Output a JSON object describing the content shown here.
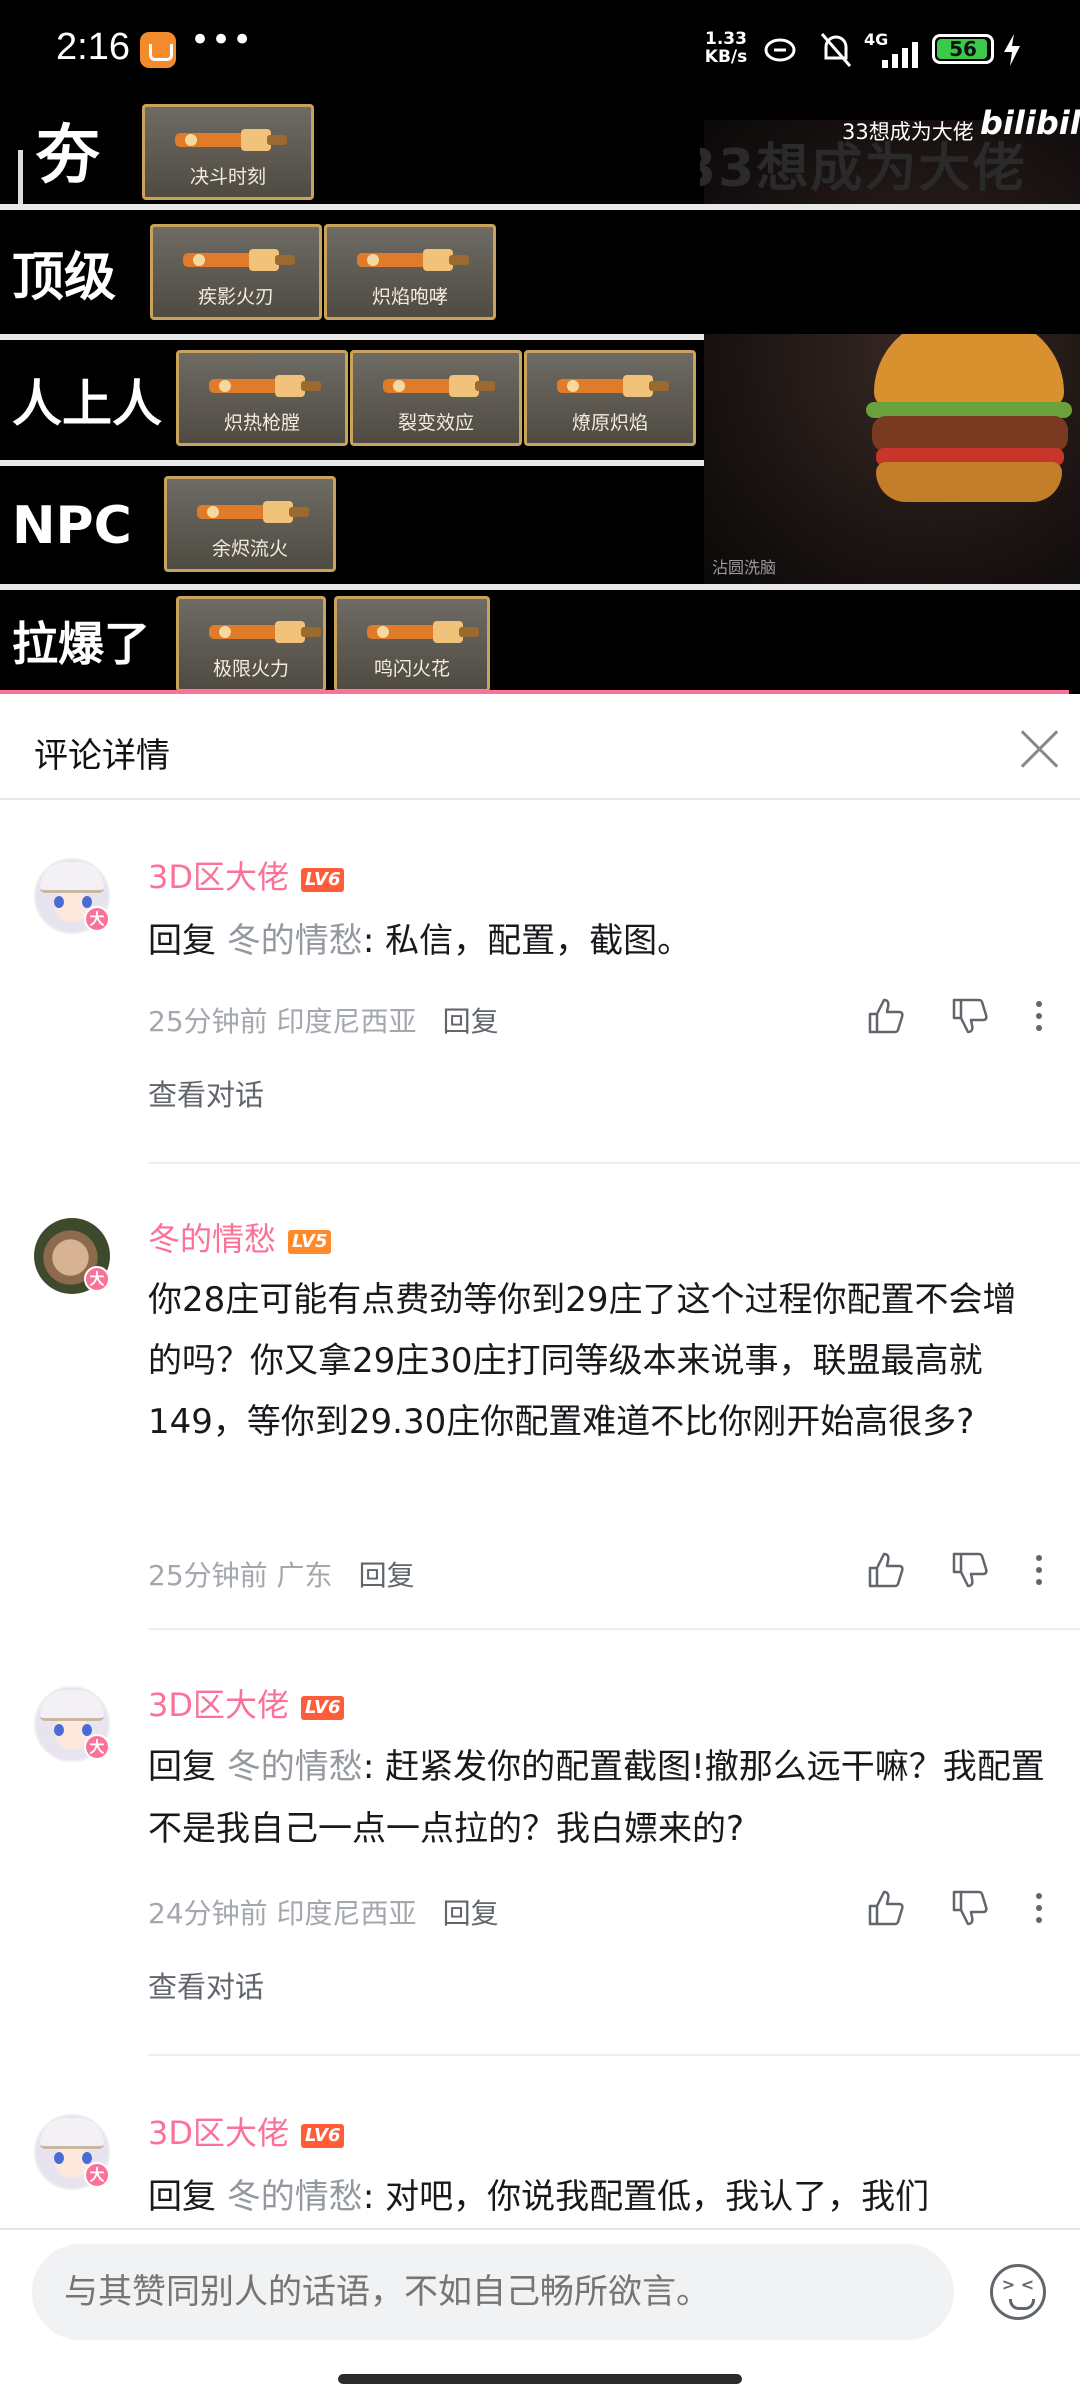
{
  "status_bar": {
    "time": "2:16",
    "more": "•••",
    "net_speed_value": "1.33",
    "net_speed_unit": "KB/s",
    "network": "4G",
    "battery": "56"
  },
  "video": {
    "watermark_title": "33想成为大佬",
    "watermark_sub": "33想成为大佬",
    "logo": "bilibili",
    "thumb_caption": "沾圆洗脑",
    "tiers": [
      {
        "label": "夯",
        "items": [
          "决斗时刻"
        ]
      },
      {
        "label": "顶级",
        "items": [
          "疾影火刃",
          "炽焰咆哮"
        ]
      },
      {
        "label": "人上人",
        "items": [
          "炽热枪膛",
          "裂变效应",
          "燎原炽焰"
        ]
      },
      {
        "label": "NPC",
        "items": [
          "余烬流火"
        ]
      },
      {
        "label": "拉爆了",
        "items": [
          "极限火力",
          "鸣闪火花"
        ]
      }
    ],
    "progress": 0.99
  },
  "panel": {
    "title": "评论详情"
  },
  "comments": [
    {
      "user": "3D区大佬",
      "level": "LV6",
      "reply_prefix": "回复",
      "reply_to": "冬的情愁",
      "text": ": 私信，配置，截图。",
      "time": "25分钟前",
      "location": "印度尼西亚",
      "reply_label": "回复",
      "view_conversation": "查看对话"
    },
    {
      "user": "冬的情愁",
      "level": "LV5",
      "text": "你28庄可能有点费劲等你到29庄了这个过程你配置不会增的吗？你又拿29庄30庄打同等级本来说事，联盟最高就149，等你到29.30庄你配置难道不比你刚开始高很多?",
      "time": "25分钟前",
      "location": "广东",
      "reply_label": "回复"
    },
    {
      "user": "3D区大佬",
      "level": "LV6",
      "reply_prefix": "回复",
      "reply_to": "冬的情愁",
      "text": ": 赶紧发你的配置截图!撤那么远干嘛？我配置不是我自己一点一点拉的？我白嫖来的?",
      "time": "24分钟前",
      "location": "印度尼西亚",
      "reply_label": "回复",
      "view_conversation": "查看对话"
    },
    {
      "user": "3D区大佬",
      "level": "LV6",
      "reply_prefix": "回复",
      "reply_to": "冬的情愁",
      "text": ": 对吧，你说我配置低，我认了，我们"
    }
  ],
  "vip_badge": "大",
  "input": {
    "placeholder": "与其赞同别人的话语，不如自己畅所欲言。"
  },
  "colors": {
    "accent_pink": "#fb7299",
    "level6": "#ff5c3a",
    "level5": "#ff8a2b",
    "badge_border": "#c9a35a"
  }
}
